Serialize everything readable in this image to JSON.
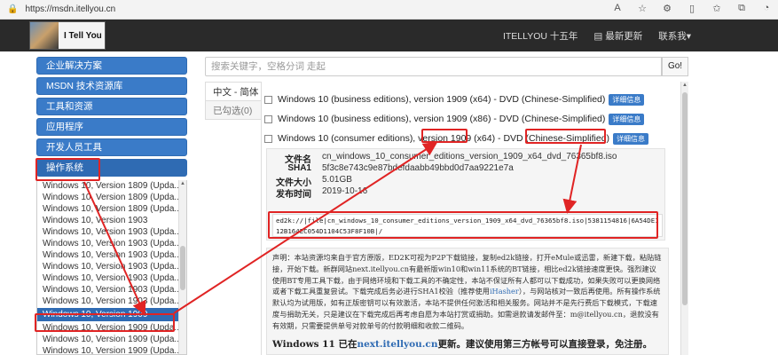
{
  "browser": {
    "url": "https://msdn.itellyou.cn"
  },
  "header": {
    "logo_text": "I Tell You",
    "nav": [
      "ITELLYOU 十五年",
      "最新更新",
      "联系我"
    ]
  },
  "sidebar": {
    "menu": [
      "企业解决方案",
      "MSDN 技术资源库",
      "工具和资源",
      "应用程序",
      "开发人员工具",
      "操作系统"
    ],
    "os_list": [
      "Windows 10, Version 1809 (Upda...",
      "Windows 10, Version 1809 (Upda...",
      "Windows 10, Version 1809 (Upda...",
      "Windows 10, Version 1903",
      "Windows 10, Version 1903 (Upda...",
      "Windows 10, Version 1903 (Upda...",
      "Windows 10, Version 1903 (Upda...",
      "Windows 10, Version 1903 (Upda...",
      "Windows 10, Version 1903 (Upda...",
      "Windows 10, Version 1903 (Upda...",
      "Windows 10, Version 1903 (Upda...",
      "Windows 10, Version 1909",
      "Windows 10, Version 1909 (Upda...",
      "Windows 10, Version 1909 (Upda...",
      "Windows 10, Version 1909 (Upda..."
    ]
  },
  "search": {
    "placeholder": "搜索关键字，空格分词 走起",
    "button": "Go!"
  },
  "tabs": [
    "中文 - 简体",
    "已勾选(0)"
  ],
  "downloads": [
    {
      "title": "Windows 10 (business editions), version 1909 (x64) - DVD (Chinese-Simplified)",
      "btn": "详细信息"
    },
    {
      "title": "Windows 10 (business editions), version 1909 (x86) - DVD (Chinese-Simplified)",
      "btn": "详细信息"
    },
    {
      "title": "Windows 10 (consumer editions), version 1909 (x64) - DVD (Chinese-Simplified)",
      "btn": "详细信息"
    }
  ],
  "detail": {
    "filename_label": "文件名",
    "filename": "cn_windows_10_consumer_editions_version_1909_x64_dvd_76365bf8.iso",
    "sha1_label": "SHA1",
    "sha1": "5f3c8e743c9e87bdefdaabb49bbd0d7aa9221e7a",
    "size_label": "文件大小",
    "size": "5.01GB",
    "date_label": "发布时间",
    "date": "2019-10-16",
    "ed2k": "ed2k://|file|cn_windows_10_consumer_editions_version_1909_x64_dvd_76365bf8.iso|5381154816|6A54DE112B164EC054D1104C53F8F10B|/"
  },
  "notice": {
    "text_before": "声明：本站资源均来自于官方原版，ED2K可视为P2P下载链接，复制ed2k链接，打开eMule或迅雷，新建下载，粘贴链接，开始下载。新群网站next.itellyou.cn有最新版win10和win11系统的BT链接，相比ed2k链接速度更快。强烈建议使用BT专用工具下载，由于网络环境和下载工具的不确定性，本站不保证所有人都可以下载成功，如果失败可以更换网络或者下载工具重复尝试。下载完成后务必进行SHA1校验（推荐使用",
    "link": "iHasher",
    "text_after": "），与网站核对一致后再使用。所有操作系统默认均为试用版，如有正版密钥可以有效激活，本站不提供任何激活和相关服务。网站并不是先行费后下载模式，下载速度与捐助无关，只是建议在下载完成后再考虑自愿为本站打赏或捐助。如需退款请发邮件至：m@itellyou.cn，退款没有有效期，只需要提供单号对款单号的付款明细和收款二维码。",
    "big_before": "Windows 11 已在",
    "big_link": "next.itellyou.cn",
    "big_after": "更新。建议使用第三方帐号可以直接登录，免注册。"
  }
}
